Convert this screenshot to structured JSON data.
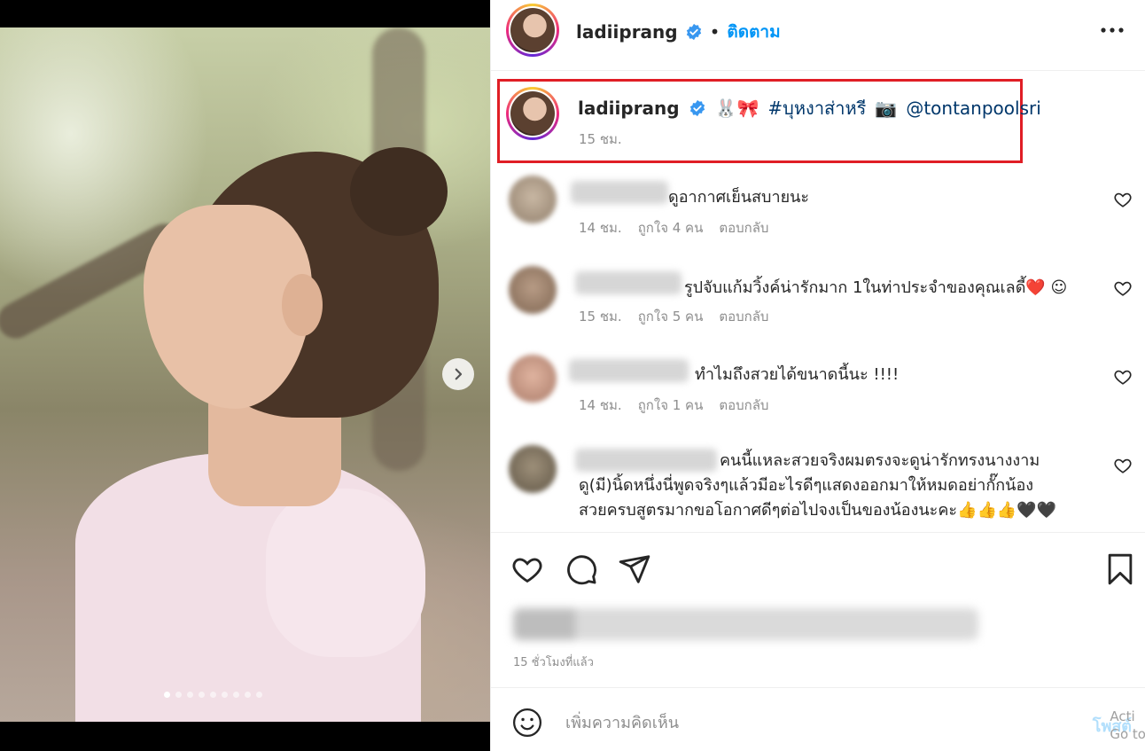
{
  "header": {
    "username": "ladiiprang",
    "bullet": "•",
    "follow_label": "ติดตาม"
  },
  "caption": {
    "username": "ladiiprang",
    "emoji": "🐰🎀",
    "hashtag": "#บุหงาส่าหรี",
    "camera": "📷",
    "mention": "@tontanpoolsri",
    "time": "15 ชม."
  },
  "comments": [
    {
      "text": "ดูอากาศเย็นสบายนะ",
      "time": "14 ชม.",
      "likes": "ถูกใจ 4 คน",
      "reply": "ตอบกลับ"
    },
    {
      "text": "รูปจับแก้มวิ้งค์น่ารักมาก 1ในท่าประจำของคุณเลดี้❤️ ☺",
      "time": "15 ชม.",
      "likes": "ถูกใจ 5 คน",
      "reply": "ตอบกลับ"
    },
    {
      "text": "ทำไมถึงสวยได้ขนาดนี้นะ !!!!",
      "time": "14 ชม.",
      "likes": "ถูกใจ 1 คน",
      "reply": "ตอบกลับ"
    },
    {
      "line1": "คนนี้แหละสวยจริงผมตรงจะดูน่ารักทรงนางงาม",
      "line2": "ดู(มี)นิ้ดหนึ่งนี่พูดจริงๆแล้วมีอะไรดีๆแสดงออกมาให้หมดอย่ากั๊กน้อง",
      "line3": "สวยครบสูตรมากขอโอกาศดีๆต่อไปจงเป็นของน้องนะคะ👍👍👍🖤🖤"
    }
  ],
  "post_time": "15 ชั่วโมงที่แล้ว",
  "composer": {
    "placeholder": "เพิ่มความคิดเห็น",
    "post_label": "โพสต์"
  },
  "watermark": {
    "line1": "Acti",
    "line2": "Go to"
  },
  "carousel": {
    "total": 9,
    "active_index": 1
  },
  "colors": {
    "accent": "#0095f6",
    "highlight_border": "#e01e25",
    "secondary_text": "#8e8e8e"
  },
  "icons": [
    "verified-badge-icon",
    "more-icon",
    "heart-icon",
    "comment-icon",
    "share-icon",
    "bookmark-icon",
    "emoji-icon",
    "chevron-right-icon"
  ]
}
